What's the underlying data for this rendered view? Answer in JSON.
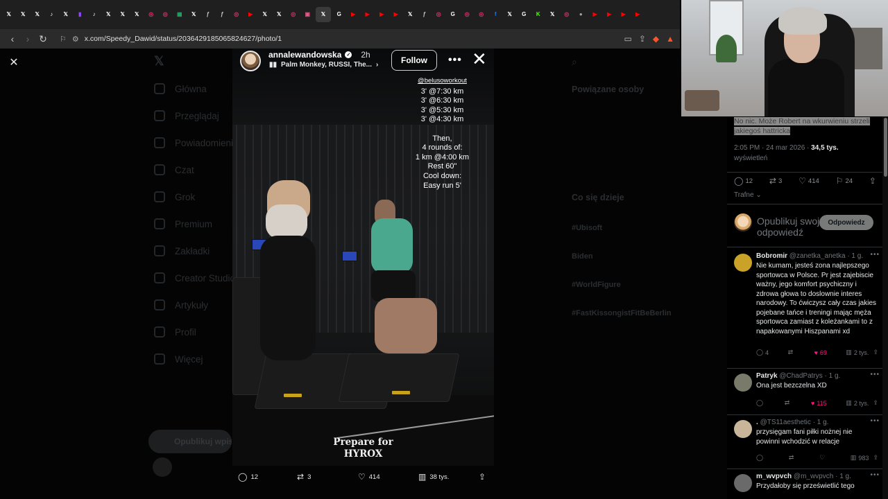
{
  "browser": {
    "tabs": [
      {
        "icon": "x-icon",
        "glyph": "𝕏",
        "color": "#ffffff"
      },
      {
        "icon": "x-icon",
        "glyph": "𝕏",
        "color": "#ffffff"
      },
      {
        "icon": "x-icon",
        "glyph": "𝕏",
        "color": "#ffffff"
      },
      {
        "icon": "tiktok-icon",
        "glyph": "♪",
        "color": "#ffffff"
      },
      {
        "icon": "x-icon",
        "glyph": "𝕏",
        "color": "#ffffff"
      },
      {
        "icon": "twitch-icon",
        "glyph": "▮",
        "color": "#9146ff"
      },
      {
        "icon": "tiktok-icon",
        "glyph": "♪",
        "color": "#ffffff"
      },
      {
        "icon": "x-icon",
        "glyph": "𝕏",
        "color": "#ffffff"
      },
      {
        "icon": "x-icon",
        "glyph": "𝕏",
        "color": "#ffffff"
      },
      {
        "icon": "x-icon",
        "glyph": "𝕏",
        "color": "#ffffff"
      },
      {
        "icon": "instagram-icon",
        "glyph": "◎",
        "color": "#e1306c"
      },
      {
        "icon": "instagram-icon",
        "glyph": "◎",
        "color": "#e1306c"
      },
      {
        "icon": "sheets-icon",
        "glyph": "▦",
        "color": "#23a566"
      },
      {
        "icon": "x-icon",
        "glyph": "𝕏",
        "color": "#ffffff"
      },
      {
        "icon": "f-icon",
        "glyph": "ƒ",
        "color": "#cccccc"
      },
      {
        "icon": "f-icon",
        "glyph": "ƒ",
        "color": "#cccccc"
      },
      {
        "icon": "instagram-icon",
        "glyph": "◎",
        "color": "#e1306c"
      },
      {
        "icon": "youtube-icon",
        "glyph": "▶",
        "color": "#ff0000"
      },
      {
        "icon": "x-icon",
        "glyph": "𝕏",
        "color": "#ffffff"
      },
      {
        "icon": "x-icon",
        "glyph": "𝕏",
        "color": "#ffffff"
      },
      {
        "icon": "instagram-icon",
        "glyph": "◎",
        "color": "#e1306c"
      },
      {
        "icon": "image-icon",
        "glyph": "▣",
        "color": "#e05a8a"
      },
      {
        "icon": "x-icon",
        "glyph": "𝕏",
        "color": "#ffffff",
        "active": true
      },
      {
        "icon": "google-icon",
        "glyph": "G",
        "color": "#ffffff"
      },
      {
        "icon": "youtube-icon",
        "glyph": "▶",
        "color": "#ff0000"
      },
      {
        "icon": "youtube-icon",
        "glyph": "▶",
        "color": "#ff0000"
      },
      {
        "icon": "youtube-icon",
        "glyph": "▶",
        "color": "#ff0000"
      },
      {
        "icon": "youtube-icon",
        "glyph": "▶",
        "color": "#ff0000"
      },
      {
        "icon": "x-icon",
        "glyph": "𝕏",
        "color": "#ffffff"
      },
      {
        "icon": "f-icon",
        "glyph": "ƒ",
        "color": "#cccccc"
      },
      {
        "icon": "instagram-icon",
        "glyph": "◎",
        "color": "#e1306c"
      },
      {
        "icon": "google-icon",
        "glyph": "G",
        "color": "#ffffff"
      },
      {
        "icon": "instagram-icon",
        "glyph": "◎",
        "color": "#e1306c"
      },
      {
        "icon": "instagram-icon",
        "glyph": "◎",
        "color": "#e1306c"
      },
      {
        "icon": "facebook-icon",
        "glyph": "f",
        "color": "#1877f2"
      },
      {
        "icon": "x-icon",
        "glyph": "𝕏",
        "color": "#ffffff"
      },
      {
        "icon": "google-icon",
        "glyph": "G",
        "color": "#ffffff"
      },
      {
        "icon": "kick-icon",
        "glyph": "K",
        "color": "#53fc18"
      },
      {
        "icon": "x-icon",
        "glyph": "𝕏",
        "color": "#ffffff"
      },
      {
        "icon": "instagram-icon",
        "glyph": "◎",
        "color": "#e1306c"
      },
      {
        "icon": "steam-icon",
        "glyph": "●",
        "color": "#9aa4ad"
      },
      {
        "icon": "youtube-icon",
        "glyph": "▶",
        "color": "#ff0000"
      },
      {
        "icon": "youtube-icon",
        "glyph": "▶",
        "color": "#ff0000"
      },
      {
        "icon": "youtube-icon",
        "glyph": "▶",
        "color": "#ff0000"
      },
      {
        "icon": "youtube-icon",
        "glyph": "▶",
        "color": "#ff0000"
      }
    ],
    "url": "x.com/Speedy_Dawid/status/2036429185065824627/photo/1"
  },
  "background_page": {
    "nav_items": [
      "Główna",
      "Przeglądaj",
      "Powiadomienia",
      "Czat",
      "Grok",
      "Premium",
      "Zakładki",
      "Creator Studio",
      "Artykuły",
      "Profil",
      "Więcej"
    ],
    "post_button": "Opublikuj wpis",
    "related_title": "Powiązane osoby",
    "trending_title": "Co się dzieje",
    "trends": [
      "#Ubisoft",
      "Biden",
      "#WorldFigure",
      "#FastKissongistFitBeBerlin"
    ]
  },
  "media": {
    "username": "annalewandowska",
    "time": "2h",
    "music": "Palm Monkey, RUSSI, The...",
    "follow_label": "Follow",
    "handle": "@belusoworkout",
    "workout_lines": [
      "3' @7:30 km",
      "3' @6:30 km",
      "3' @5:30 km",
      "3' @4:30 km",
      "",
      "Then,",
      "4 rounds of:",
      "1 km @4:00 km",
      "Rest 60\"",
      "Cool down:",
      "Easy run 5'"
    ],
    "caption_line1": "Prepare for",
    "caption_line2": "HYROX",
    "actions": {
      "replies": "12",
      "reposts": "3",
      "likes": "414",
      "views": "38 tys."
    }
  },
  "post": {
    "highlight_text": "No nic. Może Robert na wkurwieniu strzeli jakiegoś hattricka",
    "time": "2:05 PM · 24 mar 2026 · ",
    "views": "34,5 tys.",
    "views_label": "wyświetleń",
    "stats": {
      "replies": "12",
      "reposts": "3",
      "likes": "414",
      "bookmarks": "24"
    },
    "sort_label": "Trafne"
  },
  "composer": {
    "placeholder": "Opublikuj swoją odpowiedź",
    "button": "Odpowiedz"
  },
  "replies": [
    {
      "name": "Bobromir",
      "handle": "@zanetka_anetka · 1 g.",
      "text": "Nie kumam, jesteś zona najlepszego sportowca w Polsce. Pr jest zajebiscie ważny, jego komfort psychiczny i zdrowa głowa to doslownie interes narodowy. To ćwiczysz cały czas jakies pojebane tańce i treningi mając męża sportowca zamiast z koleżankami to z napakowanymi Hiszpanami xd",
      "replies": "4",
      "reposts": "",
      "likes": "69",
      "views": "2 tys.",
      "avatar_color": "#c9a227"
    },
    {
      "name": "Patryk",
      "handle": "@ChadPatrys · 1 g.",
      "text": "Ona jest bezczelna XD",
      "replies": "",
      "reposts": "",
      "likes": "115",
      "views": "2 tys.",
      "avatar_color": "#7a7a6a"
    },
    {
      "name": ".",
      "handle": "@TS11aesthetic · 1 g.",
      "text": "przysięgam fani piłki nożnej nie powinni wchodzić w relacje",
      "replies": "",
      "reposts": "",
      "likes": "",
      "views": "983",
      "avatar_color": "#c9b69a"
    },
    {
      "name": "m_wvpvch",
      "handle": "@m_wvpvch · 1 g.",
      "text": "Przydałoby się prześwietlić tego",
      "replies": "",
      "reposts": "",
      "likes": "",
      "views": "",
      "avatar_color": "#6a6a6a"
    }
  ]
}
